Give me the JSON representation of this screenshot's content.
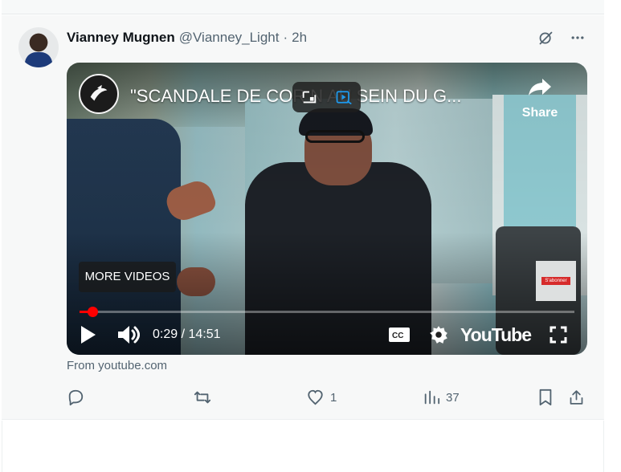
{
  "tweet": {
    "author_name": "Vianney Mugnen",
    "handle": "@Vianney_Light",
    "separator": "·",
    "time": "2h",
    "source_text": "From youtube.com",
    "actions": {
      "reply_count": "",
      "retweet_count": "",
      "like_count": "1",
      "views_count": "37"
    }
  },
  "video": {
    "title": "\"SCANDALE DE COR          N AU SEIN DU G...",
    "share_label": "Share",
    "more_videos_label": "MORE VIDEOS",
    "subscribe_label": "S'abonner",
    "time_readout": "0:29 / 14:51",
    "progress_percent": 3.3,
    "youtube_label": "YouTube",
    "progress_color": "#ff0000"
  },
  "icons": {
    "reply": "reply-icon",
    "retweet": "retweet-icon",
    "like": "heart-icon",
    "views": "bar-chart-icon",
    "bookmark": "bookmark-icon",
    "share": "share-icon",
    "more": "more-icon",
    "grok": "grok-icon"
  }
}
